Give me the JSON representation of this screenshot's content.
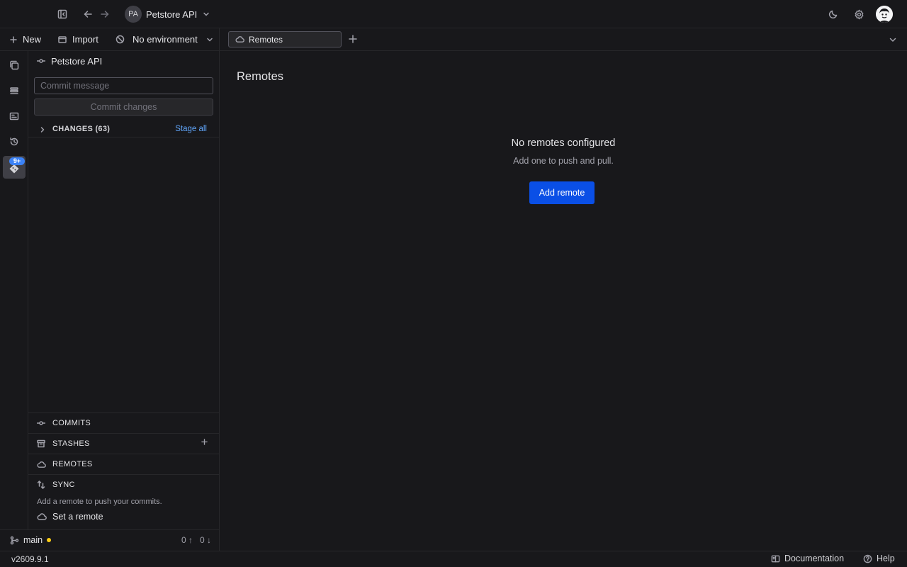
{
  "header": {
    "project_initials": "PA",
    "project_name": "Petstore API"
  },
  "toolbar": {
    "new_label": "New",
    "import_label": "Import",
    "environment_label": "No environment"
  },
  "tabs": [
    {
      "label": "Remotes",
      "icon": "cloud-icon",
      "active": true
    }
  ],
  "rail": {
    "items": [
      "collections-icon",
      "stack-icon",
      "newspaper-icon",
      "history-icon",
      "git-icon"
    ],
    "git_badge": "9+"
  },
  "panel": {
    "title": "Petstore API",
    "commit_placeholder": "Commit message",
    "commit_button": "Commit changes",
    "changes_label": "CHANGES (63)",
    "stage_all": "Stage all",
    "sections": {
      "commits": "COMMITS",
      "stashes": "STASHES",
      "remotes": "REMOTES",
      "sync": "SYNC"
    },
    "sync_hint": "Add a remote to push your commits.",
    "set_remote": "Set a remote"
  },
  "branch": {
    "name": "main",
    "ahead": "0 ↑",
    "behind": "0 ↓"
  },
  "main": {
    "title": "Remotes",
    "empty_title": "No remotes configured",
    "empty_subtitle": "Add one to push and pull.",
    "add_button": "Add remote"
  },
  "status": {
    "version": "v2609.9.1",
    "documentation": "Documentation",
    "help": "Help"
  },
  "colors": {
    "background": "#18181b",
    "accent": "#0a4fe6",
    "link": "#60a5fa",
    "badge": "#3b82f6",
    "branch_dot": "#facc15"
  }
}
